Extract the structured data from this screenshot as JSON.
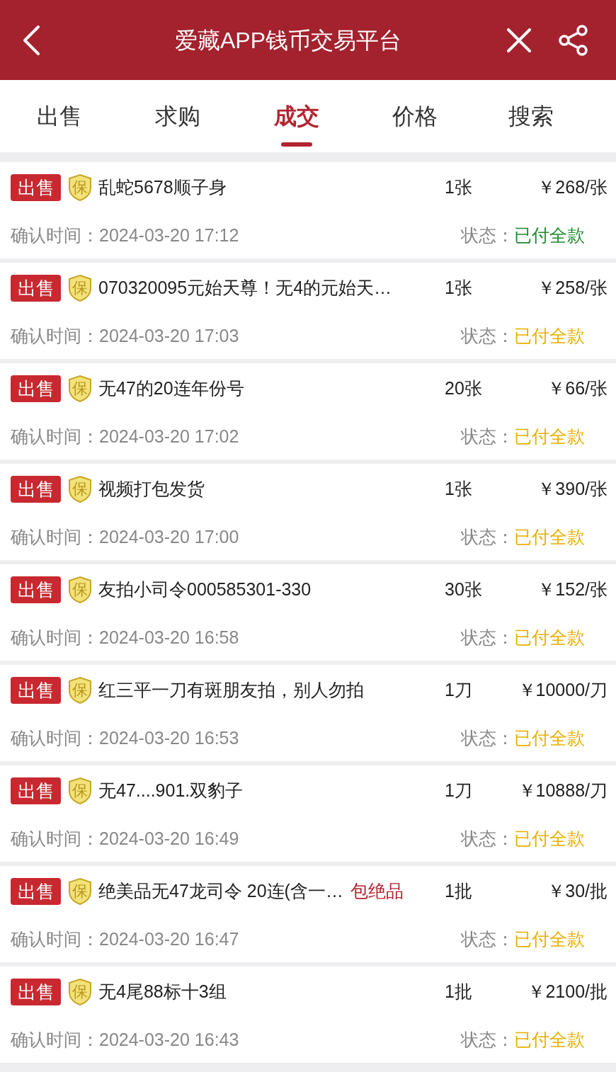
{
  "header": {
    "title": "爱藏APP钱币交易平台"
  },
  "tabs": [
    {
      "label": "出售",
      "selected": false
    },
    {
      "label": "求购",
      "selected": false
    },
    {
      "label": "成交",
      "selected": true
    },
    {
      "label": "价格",
      "selected": false
    },
    {
      "label": "搜索",
      "selected": false
    }
  ],
  "orders": [
    {
      "badge": "出售",
      "guarantee": "保",
      "title": "乱蛇5678顺子身",
      "qty": "1张",
      "price": "￥268/张",
      "time_label": "确认时间：",
      "time": "2024-03-20 17:12",
      "status_label": "状态：",
      "status": "已付全款",
      "color": "#1e8a2e"
    },
    {
      "badge": "出售",
      "guarantee": "保",
      "title": "070320095元始天尊！无4的元始天…",
      "qty": "1张",
      "price": "￥258/张",
      "time_label": "确认时间：",
      "time": "2024-03-20 17:03",
      "status_label": "状态：",
      "status": "已付全款",
      "color": "#e8b000"
    },
    {
      "badge": "出售",
      "guarantee": "保",
      "title": "无47的20连年份号",
      "qty": "20张",
      "price": "￥66/张",
      "time_label": "确认时间：",
      "time": "2024-03-20 17:02",
      "status_label": "状态：",
      "status": "已付全款",
      "color": "#e8b000"
    },
    {
      "badge": "出售",
      "guarantee": "保",
      "title": "视频打包发货",
      "qty": "1张",
      "price": "￥390/张",
      "time_label": "确认时间：",
      "time": "2024-03-20 17:00",
      "status_label": "状态：",
      "status": "已付全款",
      "color": "#e8b000"
    },
    {
      "badge": "出售",
      "guarantee": "保",
      "title": "友拍小司令000585301-330",
      "qty": "30张",
      "price": "￥152/张",
      "time_label": "确认时间：",
      "time": "2024-03-20 16:58",
      "status_label": "状态：",
      "status": "已付全款",
      "color": "#e8b000"
    },
    {
      "badge": "出售",
      "guarantee": "保",
      "title": "红三平一刀有斑朋友拍，别人勿拍",
      "qty": "1刀",
      "price": "￥10000/刀",
      "time_label": "确认时间：",
      "time": "2024-03-20 16:53",
      "status_label": "状态：",
      "status": "已付全款",
      "color": "#e8b000"
    },
    {
      "badge": "出售",
      "guarantee": "保",
      "title": "无47....901.双豹子",
      "qty": "1刀",
      "price": "￥10888/刀",
      "time_label": "确认时间：",
      "time": "2024-03-20 16:49",
      "status_label": "状态：",
      "status": "已付全款",
      "color": "#e8b000"
    },
    {
      "badge": "出售",
      "guarantee": "保",
      "title": "绝美品无47龙司令 20连(含一…",
      "tag": "包绝品",
      "qty": "1批",
      "price": "￥30/批",
      "time_label": "确认时间：",
      "time": "2024-03-20 16:47",
      "status_label": "状态：",
      "status": "已付全款",
      "color": "#e8b000"
    },
    {
      "badge": "出售",
      "guarantee": "保",
      "title": "无4尾88标十3组",
      "qty": "1批",
      "price": "￥2100/批",
      "time_label": "确认时间：",
      "time": "2024-03-20 16:43",
      "status_label": "状态：",
      "status": "已付全款",
      "color": "#e8b000"
    }
  ]
}
